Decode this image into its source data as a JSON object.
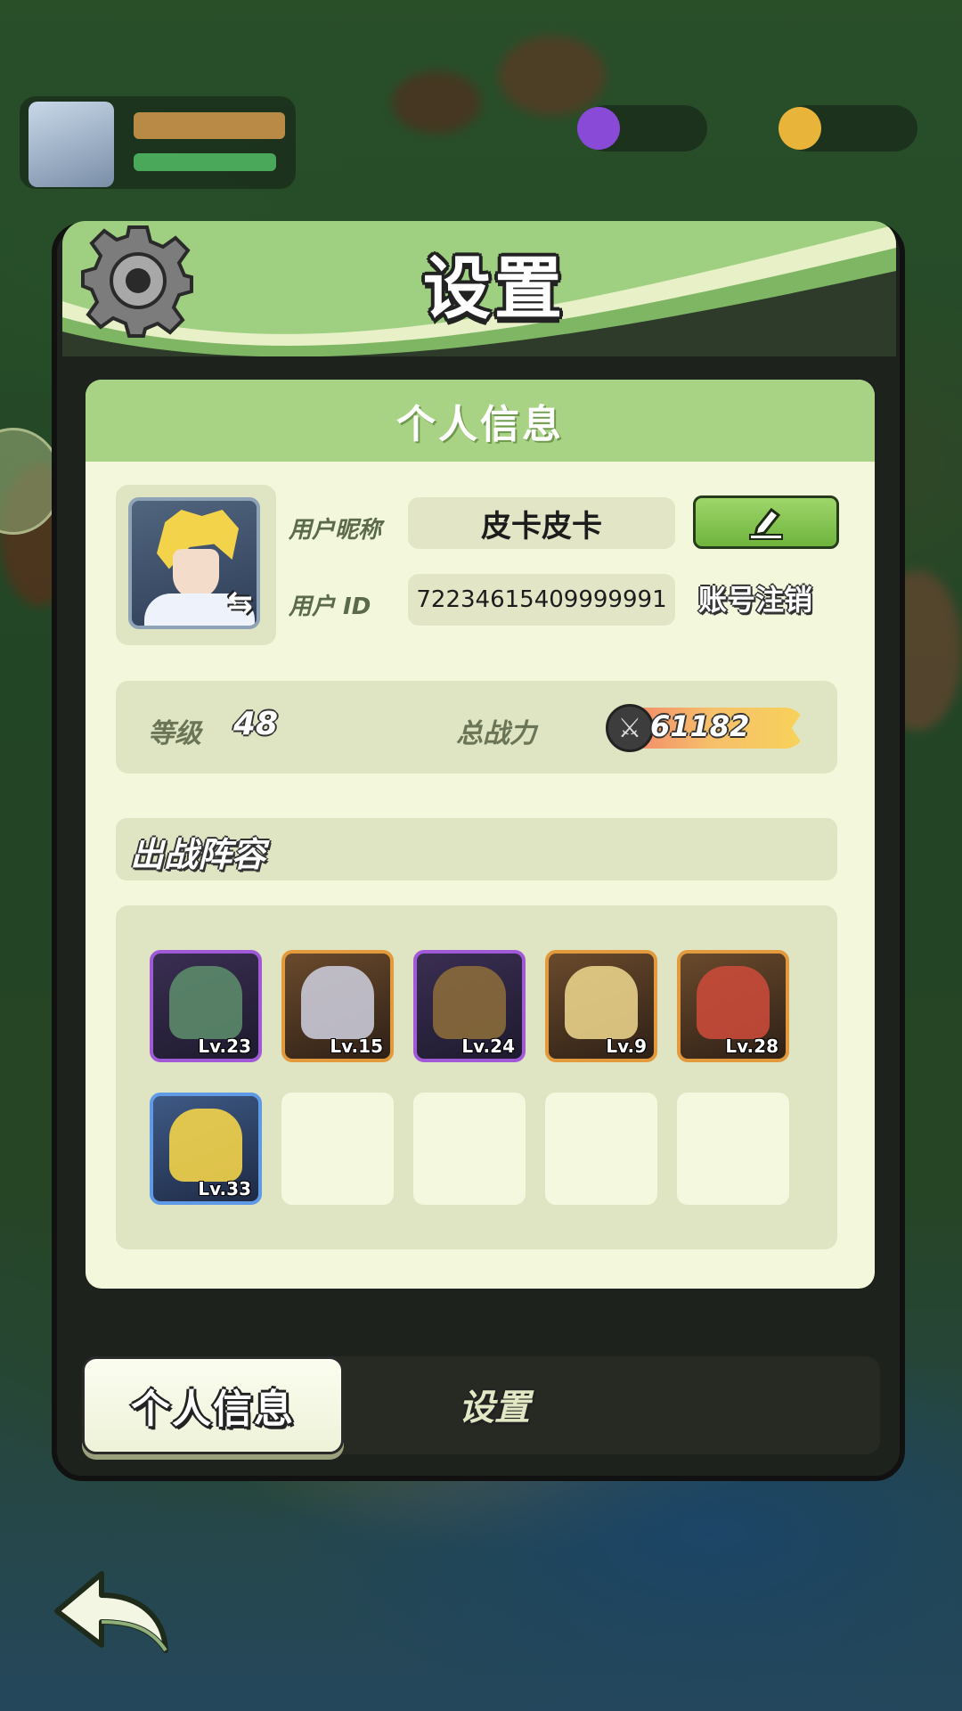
{
  "window": {
    "title": "设置"
  },
  "profile_card": {
    "header": "个人信息",
    "nickname_label": "用户昵称",
    "nickname_value": "皮卡皮卡",
    "id_label": "用户 ID",
    "id_value": "72234615409999991",
    "cancel_account_label": "账号注销",
    "edit_icon": "pencil-icon",
    "avatar_icon": "hero-portrait",
    "swap_icon": "swap-arrows-icon"
  },
  "stats": {
    "level_label": "等级",
    "level_value": "48",
    "power_label": "总战力",
    "power_value": "61182",
    "power_icon": "crossed-swords-icon"
  },
  "lineup": {
    "title": "出战阵容",
    "heroes": [
      {
        "level": "Lv.23",
        "rarity": "purple"
      },
      {
        "level": "Lv.15",
        "rarity": "orange"
      },
      {
        "level": "Lv.24",
        "rarity": "purple"
      },
      {
        "level": "Lv.9",
        "rarity": "orange"
      },
      {
        "level": "Lv.28",
        "rarity": "orange"
      },
      {
        "level": "Lv.33",
        "rarity": "blue"
      }
    ],
    "empty_slots": 4
  },
  "tabs": [
    {
      "label": "个人信息",
      "active": true
    },
    {
      "label": "设置",
      "active": false
    }
  ],
  "colors": {
    "header_green": "#a8d284",
    "card_bg": "#f3f8dc",
    "panel_border": "#111111",
    "purple_rarity": "#a05ad8",
    "orange_rarity": "#e39a3c",
    "blue_rarity": "#5e9ae6"
  },
  "back_icon": "back-arrow-icon"
}
